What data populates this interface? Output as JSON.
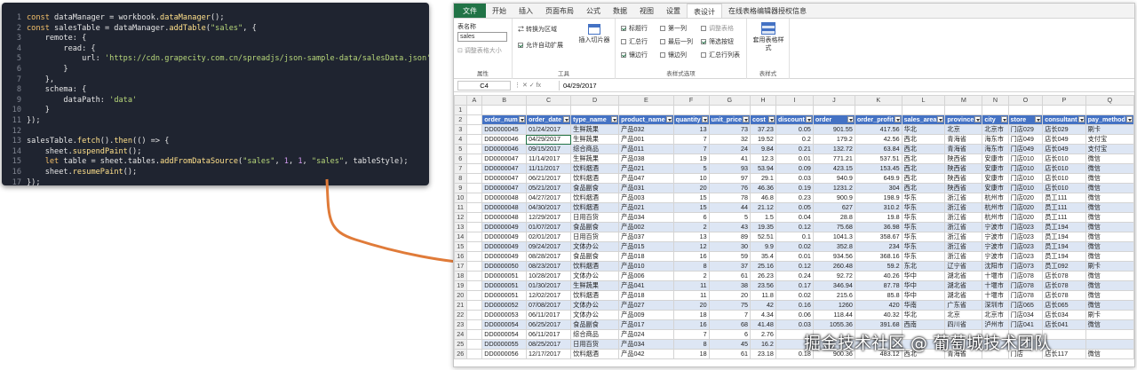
{
  "code_lines": [
    [
      {
        "t": "const ",
        "c": "kw"
      },
      {
        "t": "dataManager = workbook.",
        "c": "pn"
      },
      {
        "t": "dataManager",
        "c": "fn"
      },
      {
        "t": "();",
        "c": "pn"
      }
    ],
    [
      {
        "t": "const ",
        "c": "kw"
      },
      {
        "t": "salesTable = dataManager.",
        "c": "pn"
      },
      {
        "t": "addTable",
        "c": "fn"
      },
      {
        "t": "(",
        "c": "pn"
      },
      {
        "t": "\"sales\"",
        "c": "str"
      },
      {
        "t": ", {",
        "c": "pn"
      }
    ],
    [
      {
        "t": "    remote: {",
        "c": "pn"
      }
    ],
    [
      {
        "t": "        read: {",
        "c": "pn"
      }
    ],
    [
      {
        "t": "            url: ",
        "c": "pn"
      },
      {
        "t": "'https://cdn.grapecity.com.cn/spreadjs/json-sample-data/salesData.json'",
        "c": "str"
      }
    ],
    [
      {
        "t": "        }",
        "c": "pn"
      }
    ],
    [
      {
        "t": "    },",
        "c": "pn"
      }
    ],
    [
      {
        "t": "    schema: {",
        "c": "pn"
      }
    ],
    [
      {
        "t": "        dataPath: ",
        "c": "pn"
      },
      {
        "t": "'data'",
        "c": "str"
      }
    ],
    [
      {
        "t": "    }",
        "c": "pn"
      }
    ],
    [
      {
        "t": "});",
        "c": "pn"
      }
    ],
    [
      {
        "t": "",
        "c": "pn"
      }
    ],
    [
      {
        "t": "salesTable.",
        "c": "pn"
      },
      {
        "t": "fetch",
        "c": "fn"
      },
      {
        "t": "().",
        "c": "pn"
      },
      {
        "t": "then",
        "c": "fn"
      },
      {
        "t": "(() => {",
        "c": "pn"
      }
    ],
    [
      {
        "t": "    sheet.",
        "c": "pn"
      },
      {
        "t": "suspendPaint",
        "c": "fn"
      },
      {
        "t": "();",
        "c": "pn"
      }
    ],
    [
      {
        "t": "    let ",
        "c": "kw"
      },
      {
        "t": "table = sheet.tables.",
        "c": "pn"
      },
      {
        "t": "addFromDataSource",
        "c": "fn"
      },
      {
        "t": "(",
        "c": "pn"
      },
      {
        "t": "\"sales\"",
        "c": "str"
      },
      {
        "t": ", ",
        "c": "pn"
      },
      {
        "t": "1",
        "c": "nm"
      },
      {
        "t": ", ",
        "c": "pn"
      },
      {
        "t": "1",
        "c": "nm"
      },
      {
        "t": ", ",
        "c": "pn"
      },
      {
        "t": "\"sales\"",
        "c": "str"
      },
      {
        "t": ", tableStyle);",
        "c": "pn"
      }
    ],
    [
      {
        "t": "    sheet.",
        "c": "pn"
      },
      {
        "t": "resumePaint",
        "c": "fn"
      },
      {
        "t": "();",
        "c": "pn"
      }
    ],
    [
      {
        "t": "});",
        "c": "pn"
      }
    ]
  ],
  "excel": {
    "tabs": [
      "文件",
      "开始",
      "插入",
      "页面布局",
      "公式",
      "数据",
      "视图",
      "设置",
      "表设计",
      "在线表格编辑器授权信息"
    ],
    "active_tab": "表设计",
    "ribbon": {
      "name_label": "表名称",
      "table_name": "sales",
      "resize_label": "调整表格大小",
      "group_props": "属性",
      "convert": "转换为区域",
      "autoexpand": "允许自动扩展",
      "insert_slicer": "插入切片器",
      "group_tools": "工具",
      "opt_header": "标题行",
      "opt_total": "汇总行",
      "opt_banded_rows": "镶边行",
      "opt_first_col": "第一列",
      "opt_last_col": "最后一列",
      "opt_banded_cols": "镶边列",
      "opt_resize": "调整表格",
      "opt_filter": "筛选按钮",
      "opt_total_list": "汇总行列表",
      "group_style_opts": "表样式选项",
      "table_styles": "套用表格样式",
      "group_styles": "表样式"
    },
    "namebox": "C4",
    "formula": "04/29/2017",
    "col_letters": [
      "A",
      "B",
      "C",
      "D",
      "E",
      "F",
      "G",
      "H",
      "I",
      "J",
      "K",
      "L",
      "M",
      "N",
      "O",
      "P",
      "Q"
    ],
    "headers": [
      "order_num",
      "order_date",
      "type_name",
      "product_name",
      "quantity",
      "unit_price",
      "cost",
      "discount",
      "order",
      "order_profit",
      "sales_area",
      "province",
      "city",
      "store",
      "consultant",
      "pay_method"
    ],
    "rows": [
      [
        "DD0000045",
        "01/24/2017",
        "生鲜蔬果",
        "产品032",
        "13",
        "73",
        "37.23",
        "0.05",
        "901.55",
        "417.56",
        "华北",
        "北京",
        "北京市",
        "门店029",
        "店长029",
        "刷卡"
      ],
      [
        "DD0000046",
        "04/29/2017",
        "生鲜蔬果",
        "产品001",
        "7",
        "32",
        "19.52",
        "0.2",
        "179.2",
        "42.56",
        "西北",
        "青海省",
        "海东市",
        "门店049",
        "店长049",
        "支付宝"
      ],
      [
        "DD0000046",
        "09/15/2017",
        "综合商品",
        "产品011",
        "7",
        "24",
        "9.84",
        "0.21",
        "132.72",
        "63.84",
        "西北",
        "青海省",
        "海东市",
        "门店049",
        "店长049",
        "支付宝"
      ],
      [
        "DD0000047",
        "11/14/2017",
        "生鲜蔬果",
        "产品038",
        "19",
        "41",
        "12.3",
        "0.01",
        "771.21",
        "537.51",
        "西北",
        "陕西省",
        "安康市",
        "门店010",
        "店长010",
        "微信"
      ],
      [
        "DD0000047",
        "11/11/2017",
        "饮料烟酒",
        "产品021",
        "5",
        "93",
        "53.94",
        "0.09",
        "423.15",
        "153.45",
        "西北",
        "陕西省",
        "安康市",
        "门店010",
        "店长010",
        "微信"
      ],
      [
        "DD0000047",
        "06/21/2017",
        "饮料烟酒",
        "产品047",
        "10",
        "97",
        "29.1",
        "0.03",
        "940.9",
        "649.9",
        "西北",
        "陕西省",
        "安康市",
        "门店010",
        "店长010",
        "微信"
      ],
      [
        "DD0000047",
        "05/21/2017",
        "食品副食",
        "产品031",
        "20",
        "76",
        "46.36",
        "0.19",
        "1231.2",
        "304",
        "西北",
        "陕西省",
        "安康市",
        "门店010",
        "店长010",
        "微信"
      ],
      [
        "DD0000048",
        "04/27/2017",
        "饮料烟酒",
        "产品003",
        "15",
        "78",
        "46.8",
        "0.23",
        "900.9",
        "198.9",
        "华东",
        "浙江省",
        "杭州市",
        "门店020",
        "员工111",
        "微信"
      ],
      [
        "DD0000048",
        "04/30/2017",
        "饮料烟酒",
        "产品021",
        "15",
        "44",
        "21.12",
        "0.05",
        "627",
        "310.2",
        "华东",
        "浙江省",
        "杭州市",
        "门店020",
        "员工111",
        "微信"
      ],
      [
        "DD0000048",
        "12/29/2017",
        "日用百货",
        "产品034",
        "6",
        "5",
        "1.5",
        "0.04",
        "28.8",
        "19.8",
        "华东",
        "浙江省",
        "杭州市",
        "门店020",
        "员工111",
        "微信"
      ],
      [
        "DD0000049",
        "01/07/2017",
        "食品副食",
        "产品002",
        "2",
        "43",
        "19.35",
        "0.12",
        "75.68",
        "36.98",
        "华东",
        "浙江省",
        "宁波市",
        "门店023",
        "员工194",
        "微信"
      ],
      [
        "DD0000049",
        "02/01/2017",
        "日用百货",
        "产品037",
        "13",
        "89",
        "52.51",
        "0.1",
        "1041.3",
        "358.67",
        "华东",
        "浙江省",
        "宁波市",
        "门店023",
        "员工194",
        "微信"
      ],
      [
        "DD0000049",
        "09/24/2017",
        "文体办公",
        "产品015",
        "12",
        "30",
        "9.9",
        "0.02",
        "352.8",
        "234",
        "华东",
        "浙江省",
        "宁波市",
        "门店023",
        "员工194",
        "微信"
      ],
      [
        "DD0000049",
        "08/28/2017",
        "食品副食",
        "产品018",
        "16",
        "59",
        "35.4",
        "0.01",
        "934.56",
        "368.16",
        "华东",
        "浙江省",
        "宁波市",
        "门店023",
        "员工194",
        "微信"
      ],
      [
        "DD0000050",
        "08/23/2017",
        "饮料烟酒",
        "产品010",
        "8",
        "37",
        "25.16",
        "0.12",
        "260.48",
        "59.2",
        "东北",
        "辽宁省",
        "沈阳市",
        "门店073",
        "员工092",
        "刷卡"
      ],
      [
        "DD0000051",
        "10/28/2017",
        "文体办公",
        "产品006",
        "2",
        "61",
        "26.23",
        "0.24",
        "92.72",
        "40.26",
        "华中",
        "湖北省",
        "十堰市",
        "门店078",
        "店长078",
        "微信"
      ],
      [
        "DD0000051",
        "01/30/2017",
        "生鲜蔬果",
        "产品041",
        "11",
        "38",
        "23.56",
        "0.17",
        "346.94",
        "87.78",
        "华中",
        "湖北省",
        "十堰市",
        "门店078",
        "店长078",
        "微信"
      ],
      [
        "DD0000051",
        "12/02/2017",
        "饮料烟酒",
        "产品018",
        "11",
        "20",
        "11.8",
        "0.02",
        "215.6",
        "85.8",
        "华中",
        "湖北省",
        "十堰市",
        "门店078",
        "店长078",
        "微信"
      ],
      [
        "DD0000052",
        "07/08/2017",
        "文体办公",
        "产品027",
        "20",
        "75",
        "42",
        "0.16",
        "1260",
        "420",
        "华南",
        "广东省",
        "深圳市",
        "门店065",
        "店长065",
        "微信"
      ],
      [
        "DD0000053",
        "06/11/2017",
        "文体办公",
        "产品009",
        "18",
        "7",
        "4.34",
        "0.06",
        "118.44",
        "40.32",
        "华北",
        "北京",
        "北京市",
        "门店034",
        "店长034",
        "刷卡"
      ],
      [
        "DD0000054",
        "06/25/2017",
        "食品副食",
        "产品017",
        "16",
        "68",
        "41.48",
        "0.03",
        "1055.36",
        "391.68",
        "西南",
        "四川省",
        "泸州市",
        "门店041",
        "店长041",
        "微信"
      ],
      [
        "DD0000054",
        "06/11/2017",
        "综合商品",
        "产品024",
        "7",
        "6",
        "2.76",
        "",
        "",
        "",
        "",
        "",
        "",
        "",
        "",
        ""
      ],
      [
        "DD0000055",
        "08/25/2017",
        "日用百货",
        "产品034",
        "8",
        "45",
        "16.2",
        "",
        "",
        "",
        "",
        "",
        "",
        "",
        "",
        ""
      ],
      [
        "DD0000056",
        "12/17/2017",
        "饮料烟酒",
        "产品042",
        "18",
        "61",
        "23.18",
        "0.18",
        "900.36",
        "483.12",
        "西北",
        "青海省",
        "",
        "门店",
        "店长117",
        "微信"
      ]
    ]
  },
  "watermark": "掘金技术社区 @ 葡萄城技术团队"
}
